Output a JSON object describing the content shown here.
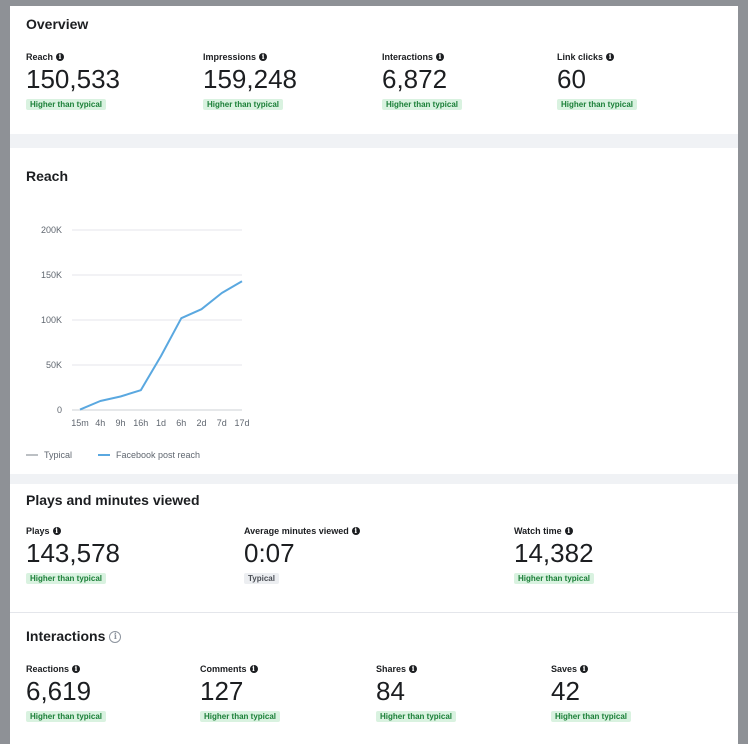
{
  "overview": {
    "title": "Overview",
    "metrics": [
      {
        "label": "Reach",
        "value": "150,533",
        "badge": "Higher than typical"
      },
      {
        "label": "Impressions",
        "value": "159,248",
        "badge": "Higher than typical"
      },
      {
        "label": "Interactions",
        "value": "6,872",
        "badge": "Higher than typical"
      },
      {
        "label": "Link clicks",
        "value": "60",
        "badge": "Higher than typical"
      }
    ]
  },
  "reach": {
    "title": "Reach",
    "chart_data": {
      "type": "line",
      "title": "Reach",
      "x": [
        "15m",
        "4h",
        "9h",
        "16h",
        "1d",
        "6h",
        "2d",
        "7d",
        "17d"
      ],
      "x_tick_labels": [
        "15m",
        "4h",
        "9h",
        "16h",
        "1d",
        "6h",
        "2d",
        "7d",
        "17d"
      ],
      "ylim": [
        0,
        200000
      ],
      "y_ticks": [
        0,
        50000,
        100000,
        150000,
        200000
      ],
      "y_tick_labels": [
        "0",
        "50K",
        "100K",
        "150K",
        "200K"
      ],
      "grid": true,
      "legend_position": "bottom-left",
      "series": [
        {
          "name": "Typical",
          "values": [],
          "color": "#bcc0c4"
        },
        {
          "name": "Facebook post reach",
          "color": "#5aa8e0",
          "values": [
            500,
            10000,
            15000,
            22000,
            60000,
            102000,
            112000,
            130000,
            143000
          ]
        }
      ]
    },
    "legend": [
      "Typical",
      "Facebook post reach"
    ]
  },
  "plays": {
    "title": "Plays and minutes viewed",
    "metrics": [
      {
        "label": "Plays",
        "value": "143,578",
        "badge": "Higher than typical"
      },
      {
        "label": "Average minutes viewed",
        "value": "0:07",
        "badge": "Typical"
      },
      {
        "label": "Watch time",
        "value": "14,382",
        "badge": "Higher than typical"
      }
    ]
  },
  "interactions": {
    "title": "Interactions",
    "metrics": [
      {
        "label": "Reactions",
        "value": "6,619",
        "badge": "Higher than typical"
      },
      {
        "label": "Comments",
        "value": "127",
        "badge": "Higher than typical"
      },
      {
        "label": "Shares",
        "value": "84",
        "badge": "Higher than typical"
      },
      {
        "label": "Saves",
        "value": "42",
        "badge": "Higher than typical"
      }
    ]
  }
}
